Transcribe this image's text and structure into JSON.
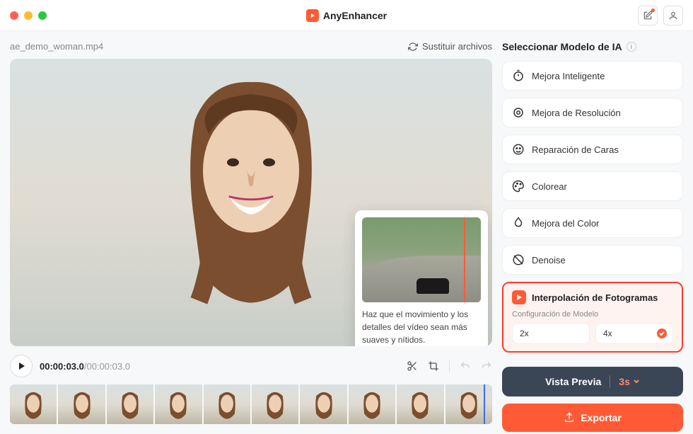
{
  "app": {
    "name": "AnyEnhancer"
  },
  "file": {
    "name": "ae_demo_woman.mp4",
    "replace_label": "Sustituir archivos"
  },
  "playback": {
    "current": "00:00:03.0",
    "total": "/00:00:03.0"
  },
  "tooltip": {
    "text": "Haz que el movimiento y los detalles del vídeo sean más suaves y nítidos."
  },
  "panel": {
    "title": "Seleccionar Modelo de IA",
    "models": [
      {
        "label": "Mejora Inteligente"
      },
      {
        "label": "Mejora de Resolución"
      },
      {
        "label": "Reparación de Caras"
      },
      {
        "label": "Colorear"
      },
      {
        "label": "Mejora del Color"
      },
      {
        "label": "Denoise"
      }
    ],
    "selected": {
      "label": "Interpolación de Fotogramas",
      "config_label": "Configuración de Modelo",
      "options": [
        {
          "label": "2x",
          "checked": false
        },
        {
          "label": "4x",
          "checked": true
        }
      ]
    }
  },
  "actions": {
    "preview": "Vista Previa",
    "preview_duration": "3s",
    "export": "Exportar"
  }
}
